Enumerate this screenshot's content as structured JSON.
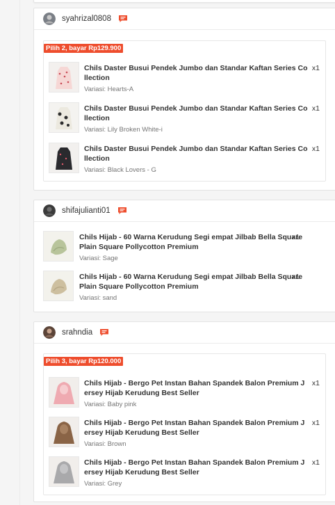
{
  "colors": {
    "accent": "#ee4d2d",
    "text": "#333333",
    "muted": "#757575"
  },
  "shops": [
    {
      "username": "syahrizal0808",
      "promo": "Pilih 2, bayar Rp129.900",
      "items": [
        {
          "name": "Chils Daster Busui Pendek Jumbo dan Standar Kaftan Series Collection",
          "qty": "x1",
          "variant": "Variasi: Hearts-A"
        },
        {
          "name": "Chils Daster Busui Pendek Jumbo dan Standar Kaftan Series Collection",
          "qty": "x1",
          "variant": "Variasi: Lily Broken White-i"
        },
        {
          "name": "Chils Daster Busui Pendek Jumbo dan Standar Kaftan Series Collection",
          "qty": "x1",
          "variant": "Variasi: Black Lovers - G"
        }
      ]
    },
    {
      "username": "shifajulianti01",
      "promo": "",
      "items": [
        {
          "name": "Chils Hijab - 60 Warna Kerudung Segi empat Jilbab Bella Square Plain Square Pollycotton Premium",
          "qty": "x1",
          "variant": "Variasi: Sage"
        },
        {
          "name": "Chils Hijab - 60 Warna Kerudung Segi empat Jilbab Bella Square Plain Square Pollycotton Premium",
          "qty": "x1",
          "variant": "Variasi: sand"
        }
      ]
    },
    {
      "username": "srahndia",
      "promo": "Pilih 3, bayar Rp120.000",
      "items": [
        {
          "name": "Chils Hijab - Bergo Pet Instan Bahan Spandek Balon Premium Jersey Hijab Kerudung Best Seller",
          "qty": "x1",
          "variant": "Variasi: Baby pink"
        },
        {
          "name": "Chils Hijab - Bergo Pet Instan Bahan Spandek Balon Premium Jersey Hijab Kerudung Best Seller",
          "qty": "x1",
          "variant": "Variasi: Brown"
        },
        {
          "name": "Chils Hijab - Bergo Pet Instan Bahan Spandek Balon Premium Jersey Hijab Kerudung Best Seller",
          "qty": "x1",
          "variant": "Variasi: Grey"
        }
      ]
    }
  ]
}
